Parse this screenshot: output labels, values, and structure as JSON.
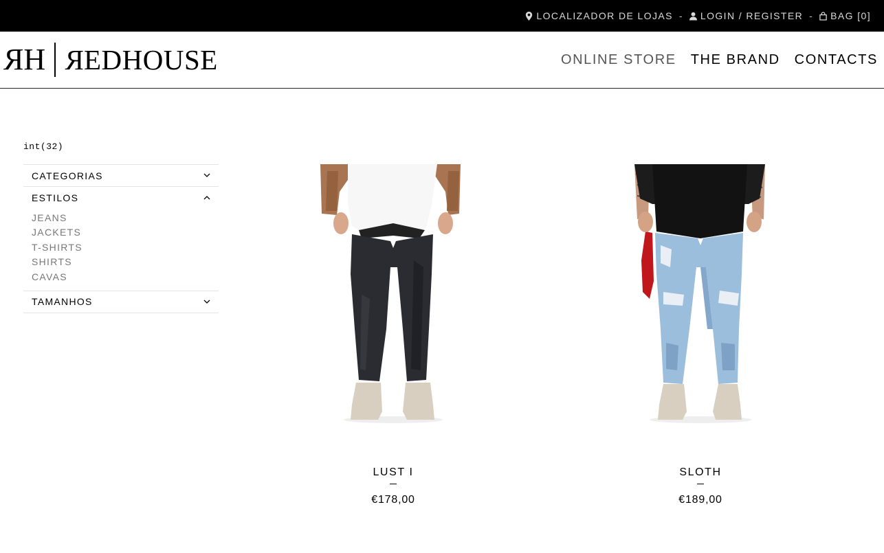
{
  "topbar": {
    "store_locator": "LOCALIZADOR DE LOJAS",
    "login": "LOGIN / REGISTER",
    "bag": "BAG [0]",
    "separator": "-",
    "icons": {
      "store_locator": "map-pin-icon",
      "login": "user-icon",
      "bag": "bag-icon"
    }
  },
  "logo": {
    "monogram": "RH",
    "wordmark": "EDHOUSE",
    "wordmark_first_letter": "R"
  },
  "nav": {
    "items": [
      {
        "label": "ONLINE STORE",
        "active": true
      },
      {
        "label": "THE BRAND",
        "active": false
      },
      {
        "label": "CONTACTS",
        "active": false
      }
    ]
  },
  "results": {
    "count_label": "int(32)"
  },
  "filters": {
    "categorias": {
      "label": "CATEGORIAS",
      "expanded": false
    },
    "estilos": {
      "label": "ESTILOS",
      "expanded": true,
      "options": [
        "JEANS",
        "JACKETS",
        "T-SHIRTS",
        "SHIRTS",
        "CAVAS"
      ]
    },
    "tamanhos": {
      "label": "TAMANHOS",
      "expanded": false
    }
  },
  "products": [
    {
      "name": "LUST I",
      "price": "€178,00"
    },
    {
      "name": "SLOTH",
      "price": "€189,00"
    }
  ],
  "colors": {
    "topbar_bg": "#000000",
    "accent": "#000000",
    "muted_text": "#777777",
    "red_bandana": "#c0171d",
    "light_denim": "#9bbedd",
    "dark_denim": "#2a2c31"
  }
}
